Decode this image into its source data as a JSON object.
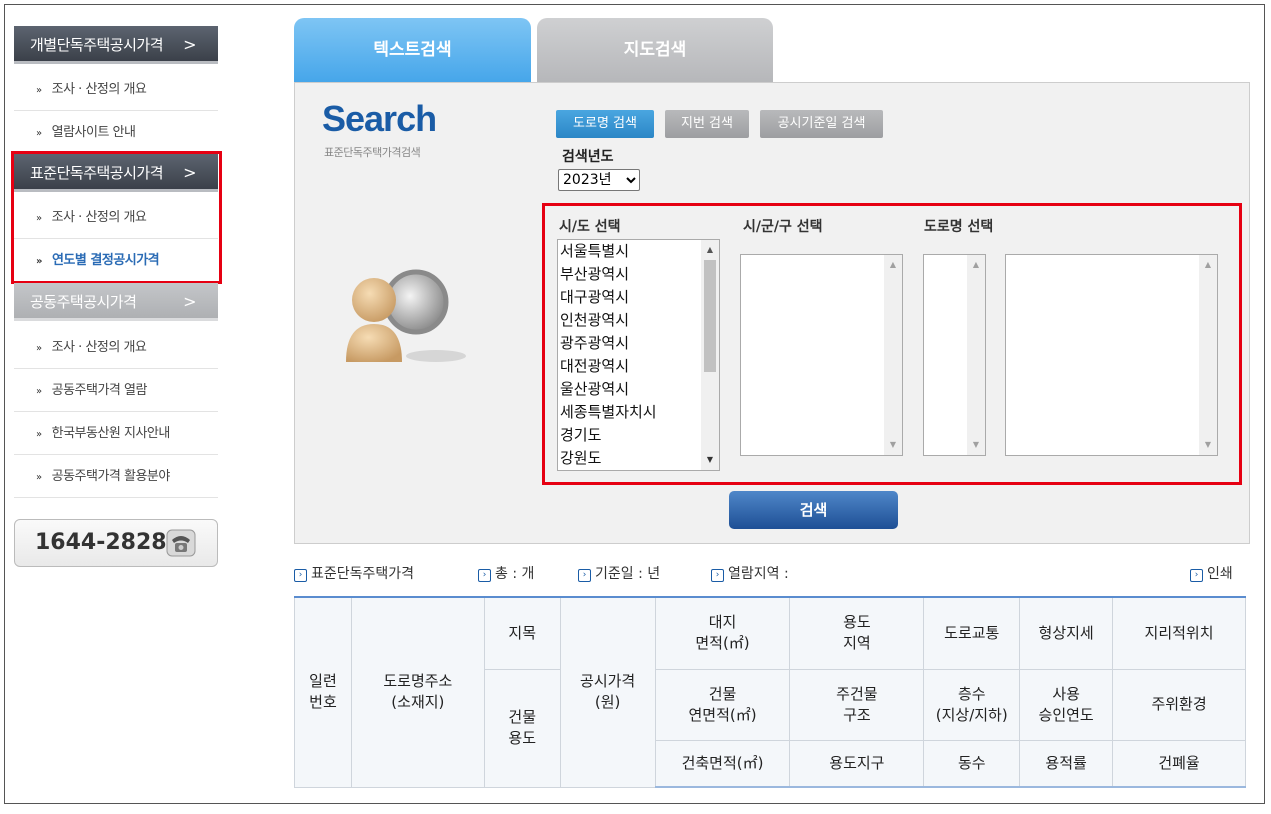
{
  "sidebar": {
    "section1": {
      "title": "개별단독주택공시가격",
      "items": [
        "조사 · 산정의 개요",
        "열람사이트 안내"
      ]
    },
    "section2": {
      "title": "표준단독주택공시가격",
      "items": [
        "조사 · 산정의 개요",
        "연도별 결정공시가격"
      ]
    },
    "section3": {
      "title": "공동주택공시가격",
      "items": [
        "조사 · 산정의 개요",
        "공동주택가격 열람",
        "한국부동산원 지사안내",
        "공동주택가격 활용분야"
      ]
    },
    "chevron": ">",
    "bullet": "»",
    "phone": "1644-2828"
  },
  "tabs": {
    "text_search": "텍스트검색",
    "map_search": "지도검색"
  },
  "search_logo": {
    "title": "Search",
    "subtitle": "표준단독주택가격검색"
  },
  "search_type_buttons": {
    "road": "도로명 검색",
    "lot": "지번 검색",
    "date": "공시기준일 검색"
  },
  "year": {
    "label": "검색년도",
    "value": "2023년"
  },
  "selectors": {
    "sido_label": "시/도 선택",
    "sigungu_label": "시/군/구 선택",
    "road_label": "도로명 선택",
    "sido_options": [
      "서울특별시",
      "부산광역시",
      "대구광역시",
      "인천광역시",
      "광주광역시",
      "대전광역시",
      "울산광역시",
      "세종특별자치시",
      "경기도",
      "강원도"
    ]
  },
  "search_button": "검색",
  "info_bar": {
    "category": "표준단독주택가격",
    "total": "총 : 개",
    "base_date": "기준일 : 년",
    "area": "열람지역 :",
    "print": "인쇄"
  },
  "table_headers": {
    "serial": "일련\n번호",
    "address": "도로명주소\n(소재지)",
    "land_category": "지목",
    "building_use": "건물\n용도",
    "price": "공시가격\n(원)",
    "land_area": "대지\n면적(㎡)",
    "zoning": "용도\n지역",
    "road": "도로교통",
    "shape": "형상지세",
    "location": "지리적위치",
    "floor_area": "건물\n연면적(㎡)",
    "structure": "주건물\n구조",
    "floors": "층수\n(지상/지하)",
    "approval_year": "사용\n승인연도",
    "environment": "주위환경",
    "building_area": "건축면적(㎡)",
    "district": "용도지구",
    "buildings": "동수",
    "far": "용적률",
    "bcr": "건폐율"
  },
  "colors": {
    "accent_blue": "#46a6ea",
    "highlight_red": "#e60012",
    "active_link": "#2a6bb5"
  }
}
